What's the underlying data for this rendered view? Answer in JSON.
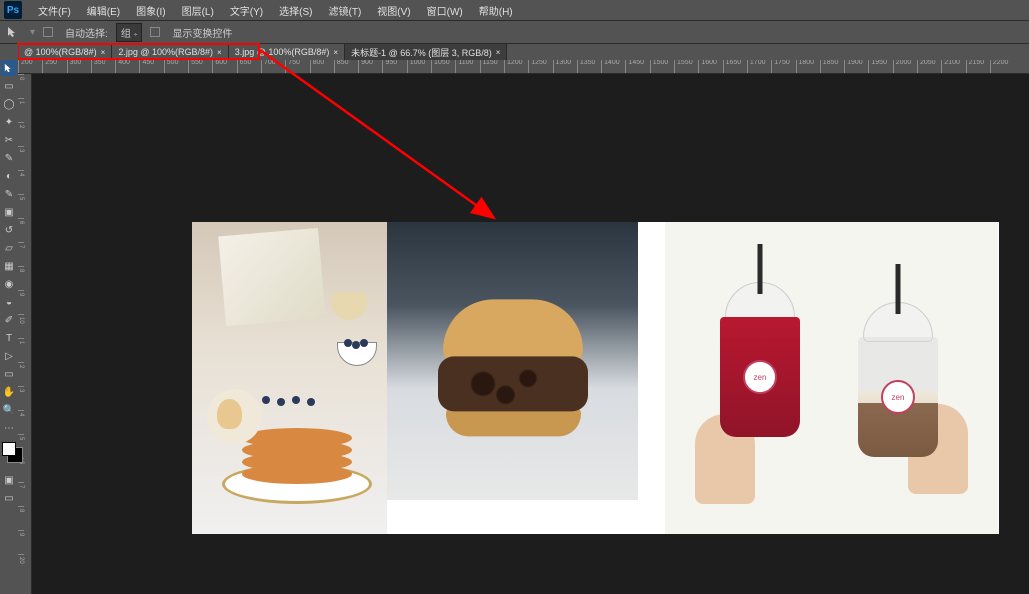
{
  "app_logo": "Ps",
  "menu": [
    "文件(F)",
    "编辑(E)",
    "图象(I)",
    "图层(L)",
    "文字(Y)",
    "选择(S)",
    "滤镜(T)",
    "视图(V)",
    "窗口(W)",
    "帮助(H)"
  ],
  "options": {
    "auto_select": "自动选择:",
    "layer_dropdown": "组",
    "show_transform": "显示变换控件"
  },
  "tabs": [
    {
      "label": "@ 100%(RGB/8#)"
    },
    {
      "label": "2.jpg @ 100%(RGB/8#)"
    },
    {
      "label": "3.jpg @ 100%(RGB/8#)"
    },
    {
      "label": "未标题-1 @ 66.7% (图层 3, RGB/8)"
    }
  ],
  "ruler_h": [
    "200",
    "250",
    "300",
    "350",
    "400",
    "450",
    "500",
    "550",
    "600",
    "650",
    "700",
    "750",
    "800",
    "850",
    "900",
    "950",
    "1000",
    "1050",
    "1100",
    "1150",
    "1200",
    "1250",
    "1300",
    "1350",
    "1400",
    "1450",
    "1500",
    "1550",
    "1600",
    "1650",
    "1700",
    "1750",
    "1800",
    "1850",
    "1900",
    "1950",
    "2000",
    "2050",
    "2100",
    "2150",
    "2200"
  ],
  "ruler_v": [
    "0",
    "1",
    "2",
    "3",
    "4",
    "5",
    "6",
    "7",
    "8",
    "9",
    "10",
    "1",
    "2",
    "3",
    "4",
    "5",
    "6",
    "7",
    "8",
    "9",
    "20"
  ],
  "drink_logo": "zen"
}
